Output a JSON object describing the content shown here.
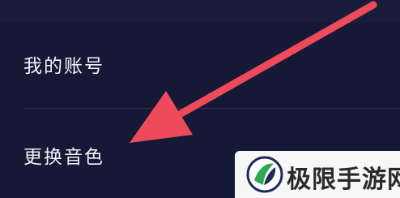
{
  "menu": {
    "items": [
      {
        "label": "我的账号"
      },
      {
        "label": "更换音色"
      }
    ]
  },
  "watermark": {
    "text": "极限手游网"
  },
  "colors": {
    "background": "#151936",
    "text": "#f2f3f7",
    "arrow": "#ee4b5a",
    "divider": "#2a2f55"
  }
}
